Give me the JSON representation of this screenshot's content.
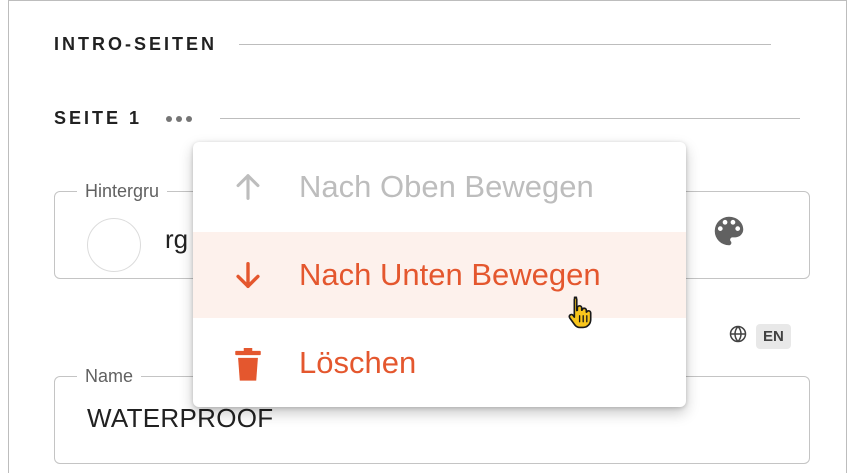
{
  "sections": {
    "intro_title": "INTRO-SEITEN",
    "page_title": "SEITE 1"
  },
  "background_field": {
    "label": "Hintergru",
    "value": "rg"
  },
  "language": {
    "code": "EN"
  },
  "name_field": {
    "label": "Name",
    "value": "WATERPROOF"
  },
  "context_menu": {
    "items": [
      {
        "label": "Nach Oben Bewegen",
        "icon": "arrow-up-icon",
        "state": "disabled"
      },
      {
        "label": "Nach Unten Bewegen",
        "icon": "arrow-down-icon",
        "state": "hovered"
      },
      {
        "label": "Löschen",
        "icon": "trash-icon",
        "state": "enabled"
      }
    ]
  },
  "colors": {
    "accent": "#e4572e",
    "hover_bg": "#fdf1ec",
    "disabled_text": "#bdbdbd",
    "border": "#c4c4c4"
  },
  "icons": {
    "more": "more-horizontal-icon",
    "palette": "palette-icon",
    "globe": "globe-icon",
    "cursor": "hand-pointer-cursor"
  }
}
